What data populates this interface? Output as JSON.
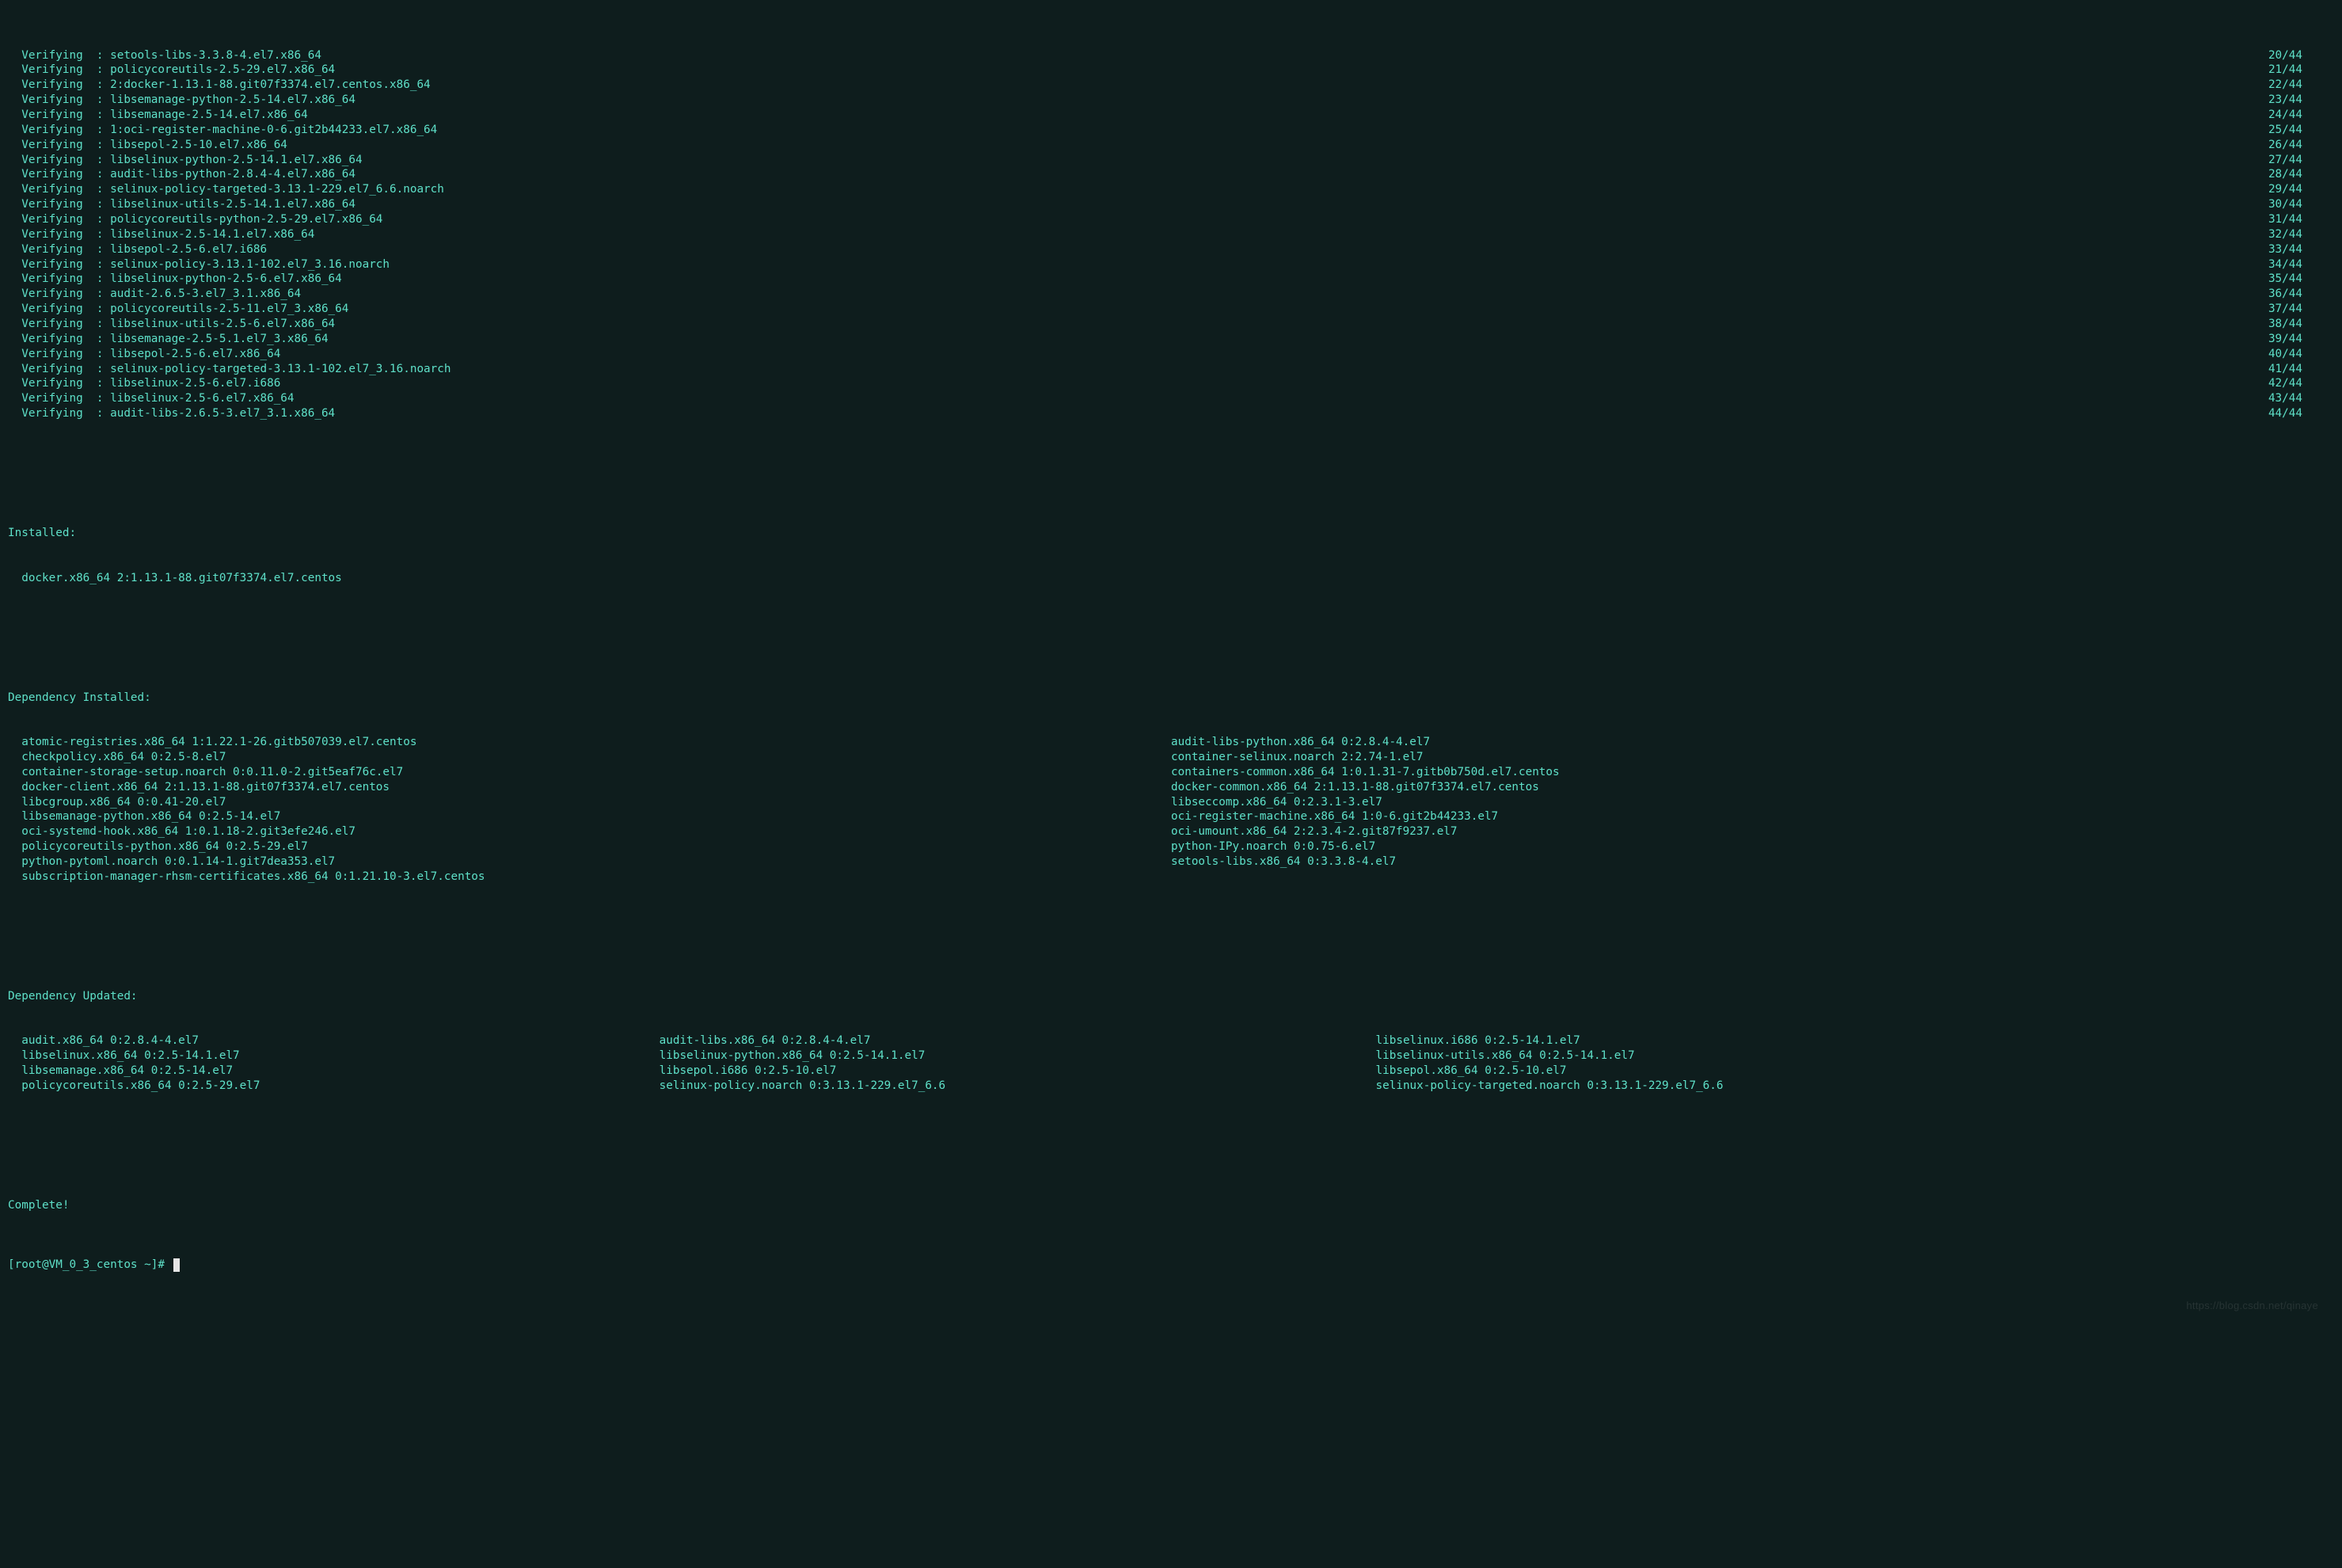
{
  "verify_prefix": "Verifying",
  "verify_sep": "  : ",
  "verifying": [
    {
      "pkg": "setools-libs-3.3.8-4.el7.x86_64",
      "n": "20/44"
    },
    {
      "pkg": "policycoreutils-2.5-29.el7.x86_64",
      "n": "21/44"
    },
    {
      "pkg": "2:docker-1.13.1-88.git07f3374.el7.centos.x86_64",
      "n": "22/44"
    },
    {
      "pkg": "libsemanage-python-2.5-14.el7.x86_64",
      "n": "23/44"
    },
    {
      "pkg": "libsemanage-2.5-14.el7.x86_64",
      "n": "24/44"
    },
    {
      "pkg": "1:oci-register-machine-0-6.git2b44233.el7.x86_64",
      "n": "25/44"
    },
    {
      "pkg": "libsepol-2.5-10.el7.x86_64",
      "n": "26/44"
    },
    {
      "pkg": "libselinux-python-2.5-14.1.el7.x86_64",
      "n": "27/44"
    },
    {
      "pkg": "audit-libs-python-2.8.4-4.el7.x86_64",
      "n": "28/44"
    },
    {
      "pkg": "selinux-policy-targeted-3.13.1-229.el7_6.6.noarch",
      "n": "29/44"
    },
    {
      "pkg": "libselinux-utils-2.5-14.1.el7.x86_64",
      "n": "30/44"
    },
    {
      "pkg": "policycoreutils-python-2.5-29.el7.x86_64",
      "n": "31/44"
    },
    {
      "pkg": "libselinux-2.5-14.1.el7.x86_64",
      "n": "32/44"
    },
    {
      "pkg": "libsepol-2.5-6.el7.i686",
      "n": "33/44"
    },
    {
      "pkg": "selinux-policy-3.13.1-102.el7_3.16.noarch",
      "n": "34/44"
    },
    {
      "pkg": "libselinux-python-2.5-6.el7.x86_64",
      "n": "35/44"
    },
    {
      "pkg": "audit-2.6.5-3.el7_3.1.x86_64",
      "n": "36/44"
    },
    {
      "pkg": "policycoreutils-2.5-11.el7_3.x86_64",
      "n": "37/44"
    },
    {
      "pkg": "libselinux-utils-2.5-6.el7.x86_64",
      "n": "38/44"
    },
    {
      "pkg": "libsemanage-2.5-5.1.el7_3.x86_64",
      "n": "39/44"
    },
    {
      "pkg": "libsepol-2.5-6.el7.x86_64",
      "n": "40/44"
    },
    {
      "pkg": "selinux-policy-targeted-3.13.1-102.el7_3.16.noarch",
      "n": "41/44"
    },
    {
      "pkg": "libselinux-2.5-6.el7.i686",
      "n": "42/44"
    },
    {
      "pkg": "libselinux-2.5-6.el7.x86_64",
      "n": "43/44"
    },
    {
      "pkg": "audit-libs-2.6.5-3.el7_3.1.x86_64",
      "n": "44/44"
    }
  ],
  "installed_header": "Installed:",
  "installed_items": [
    "docker.x86_64 2:1.13.1-88.git07f3374.el7.centos"
  ],
  "dep_installed_header": "Dependency Installed:",
  "dep_installed_rows": [
    {
      "l": "atomic-registries.x86_64 1:1.22.1-26.gitb507039.el7.centos",
      "r": "audit-libs-python.x86_64 0:2.8.4-4.el7"
    },
    {
      "l": "checkpolicy.x86_64 0:2.5-8.el7",
      "r": "container-selinux.noarch 2:2.74-1.el7"
    },
    {
      "l": "container-storage-setup.noarch 0:0.11.0-2.git5eaf76c.el7",
      "r": "containers-common.x86_64 1:0.1.31-7.gitb0b750d.el7.centos"
    },
    {
      "l": "docker-client.x86_64 2:1.13.1-88.git07f3374.el7.centos",
      "r": "docker-common.x86_64 2:1.13.1-88.git07f3374.el7.centos"
    },
    {
      "l": "libcgroup.x86_64 0:0.41-20.el7",
      "r": "libseccomp.x86_64 0:2.3.1-3.el7"
    },
    {
      "l": "libsemanage-python.x86_64 0:2.5-14.el7",
      "r": "oci-register-machine.x86_64 1:0-6.git2b44233.el7"
    },
    {
      "l": "oci-systemd-hook.x86_64 1:0.1.18-2.git3efe246.el7",
      "r": "oci-umount.x86_64 2:2.3.4-2.git87f9237.el7"
    },
    {
      "l": "policycoreutils-python.x86_64 0:2.5-29.el7",
      "r": "python-IPy.noarch 0:0.75-6.el7"
    },
    {
      "l": "python-pytoml.noarch 0:0.1.14-1.git7dea353.el7",
      "r": "setools-libs.x86_64 0:3.3.8-4.el7"
    },
    {
      "l": "subscription-manager-rhsm-certificates.x86_64 0:1.21.10-3.el7.centos",
      "r": ""
    }
  ],
  "dep_updated_header": "Dependency Updated:",
  "dep_updated_rows": [
    {
      "a": "audit.x86_64 0:2.8.4-4.el7",
      "b": "audit-libs.x86_64 0:2.8.4-4.el7",
      "c": "libselinux.i686 0:2.5-14.1.el7"
    },
    {
      "a": "libselinux.x86_64 0:2.5-14.1.el7",
      "b": "libselinux-python.x86_64 0:2.5-14.1.el7",
      "c": "libselinux-utils.x86_64 0:2.5-14.1.el7"
    },
    {
      "a": "libsemanage.x86_64 0:2.5-14.el7",
      "b": "libsepol.i686 0:2.5-10.el7",
      "c": "libsepol.x86_64 0:2.5-10.el7"
    },
    {
      "a": "policycoreutils.x86_64 0:2.5-29.el7",
      "b": "selinux-policy.noarch 0:3.13.1-229.el7_6.6",
      "c": "selinux-policy-targeted.noarch 0:3.13.1-229.el7_6.6"
    }
  ],
  "complete": "Complete!",
  "prompt": "[root@VM_0_3_centos ~]# ",
  "watermark": "https://blog.csdn.net/qinaye"
}
